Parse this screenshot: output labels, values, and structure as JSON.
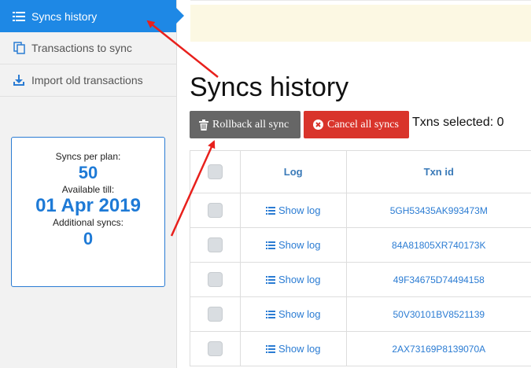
{
  "sidebar": {
    "items": [
      {
        "label": "Syncs history",
        "icon": "list-icon",
        "active": true
      },
      {
        "label": "Transactions to sync",
        "icon": "copy-icon",
        "active": false
      },
      {
        "label": "Import old transactions",
        "icon": "download-icon",
        "active": false
      }
    ],
    "stats": {
      "syncs_per_plan_label": "Syncs per plan:",
      "syncs_per_plan_value": "50",
      "available_till_label": "Available till:",
      "available_till_value": "01 Apr 2019",
      "additional_syncs_label": "Additional syncs:",
      "additional_syncs_value": "0"
    }
  },
  "main": {
    "title": "Syncs history",
    "rollback_label": "Rollback all sync",
    "cancel_label": "Cancel all syncs",
    "txns_selected": "Txns selected: 0",
    "table": {
      "headers": [
        "",
        "Log",
        "Txn id"
      ],
      "rows": [
        {
          "log": "Show log",
          "txn_id": "5GH53435AK993473M"
        },
        {
          "log": "Show log",
          "txn_id": "84A81805XR740173K"
        },
        {
          "log": "Show log",
          "txn_id": "49F34675D74494158"
        },
        {
          "log": "Show log",
          "txn_id": "50V30101BV8521139"
        },
        {
          "log": "Show log",
          "txn_id": "2AX73169P8139070A"
        }
      ]
    }
  },
  "colors": {
    "accent": "#1e88e5",
    "rollback": "#666666",
    "cancel": "#d9342b",
    "notice": "#fcf8e3",
    "annotation_arrow": "#e8201c"
  }
}
